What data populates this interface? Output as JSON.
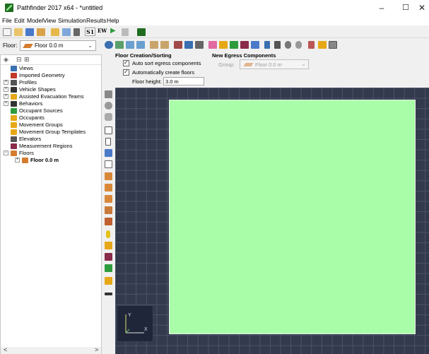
{
  "window": {
    "title": "Pathfinder 2017 x64 - *untitled",
    "minimize_glyph": "–",
    "maximize_glyph": "☐",
    "close_glyph": "✕"
  },
  "menu": [
    "File",
    "Edit",
    "Model",
    "View",
    "Simulation",
    "Results",
    "Help"
  ],
  "toolbar": {
    "s1_label": "S1",
    "ew_label": "EW",
    "run_glyph": "▶"
  },
  "floor_selector": {
    "label": "Floor:",
    "value": "Floor 0.0 m",
    "arrow": "⌄"
  },
  "tree": {
    "tools": [
      "◈",
      "⊟",
      "⊞"
    ],
    "items": [
      {
        "label": "Views",
        "icon": "views-icon",
        "color": "#3a6fb0"
      },
      {
        "label": "Imported Geometry",
        "icon": "geometry-icon",
        "color": "#c0392b"
      },
      {
        "label": "Profiles",
        "icon": "profiles-icon",
        "color": "#555555"
      },
      {
        "label": "Vehicle Shapes",
        "icon": "vehicle-icon",
        "color": "#333333"
      },
      {
        "label": "Assisted Evacuation Teams",
        "icon": "team-icon",
        "color": "#e6a817"
      },
      {
        "label": "Behaviors",
        "icon": "behavior-icon",
        "color": "#333333"
      },
      {
        "label": "Occupant Sources",
        "icon": "source-icon",
        "color": "#2e9c3d"
      },
      {
        "label": "Occupants",
        "icon": "occupant-icon",
        "color": "#e6a817"
      },
      {
        "label": "Movement Groups",
        "icon": "group-icon",
        "color": "#e6a817"
      },
      {
        "label": "Movement Group Templates",
        "icon": "template-icon",
        "color": "#e6a817"
      },
      {
        "label": "Elevators",
        "icon": "elevator-icon",
        "color": "#555555"
      },
      {
        "label": "Measurement Regions",
        "icon": "region-icon",
        "color": "#8a2b4a"
      },
      {
        "label": "Floors",
        "icon": "floors-icon",
        "color": "#d57c2f"
      },
      {
        "label": "Floor 0.0 m",
        "icon": "floor-icon",
        "color": "#d57c2f"
      }
    ],
    "scroll_left": "<",
    "scroll_right": ">"
  },
  "properties": {
    "floor_section_title": "Floor Creation/Sorting",
    "auto_sort_label": "Auto sort egress components",
    "auto_create_label": "Automatically create floors",
    "floor_height_label": "Floor height:",
    "floor_height_value": "3.0 m",
    "egress_section_title": "New Egress Components",
    "group_label": "Group:",
    "group_value": "Floor 0.0 m",
    "group_arrow": "⌄"
  },
  "axes": {
    "y_label": "Y",
    "x_label": "X"
  },
  "colors": {
    "floor_fill": "#a9fda9",
    "canvas_bg": "#333a4d",
    "grid_line": "#4b5366"
  }
}
